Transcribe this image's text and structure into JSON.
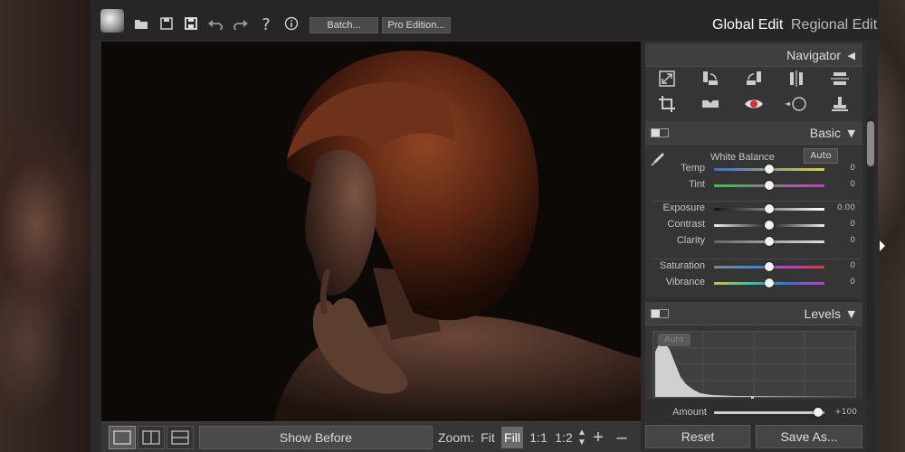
{
  "toolbar": {
    "icons": [
      "app-logo",
      "open-folder-icon",
      "save-icon",
      "save-as-icon",
      "undo-icon",
      "redo-icon",
      "help-icon",
      "info-icon"
    ],
    "batch_label": "Batch...",
    "pro_label": "Pro Edition...",
    "global_edit": "Global Edit",
    "regional_edit": "Regional Edit"
  },
  "bottom": {
    "show_before": "Show Before",
    "zoom_label": "Zoom:",
    "zoom_options": [
      "Fit",
      "Fill",
      "1:1",
      "1:2"
    ],
    "zoom_selected": "Fill"
  },
  "panel": {
    "navigator": "Navigator",
    "nav_tools": [
      "resize-icon",
      "rotate-left-icon",
      "rotate-right-icon",
      "flip-horizontal-icon",
      "flip-vertical-icon",
      "crop-icon",
      "straighten-icon",
      "red-eye-icon",
      "healing-icon",
      "clone-stamp-icon"
    ],
    "basic": {
      "title": "Basic",
      "white_balance": "White Balance",
      "auto": "Auto",
      "sliders": [
        {
          "label": "Temp",
          "value": "0",
          "position": 0.5
        },
        {
          "label": "Tint",
          "value": "0",
          "position": 0.5
        },
        {
          "label": "Exposure",
          "value": "0.00",
          "position": 0.5
        },
        {
          "label": "Contrast",
          "value": "0",
          "position": 0.5
        },
        {
          "label": "Clarity",
          "value": "0",
          "position": 0.5
        },
        {
          "label": "Saturation",
          "value": "0",
          "position": 0.5
        },
        {
          "label": "Vibrance",
          "value": "0",
          "position": 0.5
        }
      ]
    },
    "levels": {
      "title": "Levels",
      "auto": "Auto"
    },
    "amount": {
      "label": "Amount",
      "value": "+100",
      "position": 1.0
    },
    "reset": "Reset",
    "save_as": "Save As..."
  }
}
